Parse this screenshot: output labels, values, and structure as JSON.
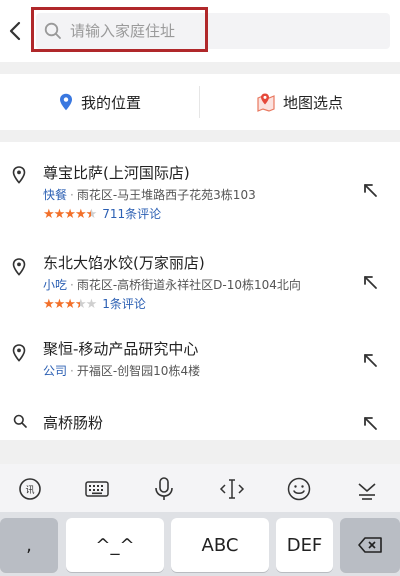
{
  "search": {
    "placeholder": "请输入家庭住址"
  },
  "location_bar": {
    "my_location": "我的位置",
    "map_pick": "地图选点"
  },
  "results": [
    {
      "name": "尊宝比萨(上河国际店)",
      "category": "快餐",
      "address": "雨花区-马王堆路西子花苑3栋103",
      "rating": 4.5,
      "reviews": "711条评论"
    },
    {
      "name": "东北大馅水饺(万家丽店)",
      "category": "小吃",
      "address": "雨花区-高桥街道永祥社区D-10栋104北向",
      "rating": 3.5,
      "reviews": "1条评论"
    },
    {
      "name": "聚恒-移动产品研究中心",
      "category": "公司",
      "address": "开福区-创智园10栋4楼"
    },
    {
      "name": "高桥肠粉"
    }
  ],
  "keyboard": {
    "keys": [
      ",",
      "^_^",
      "ABC",
      "DEF"
    ],
    "toolbar_icons": [
      "ime-logo-icon",
      "keyboard-icon",
      "microphone-icon",
      "text-cursor-icon",
      "emoji-icon",
      "collapse-keyboard-icon"
    ]
  },
  "colors": {
    "accent_blue": "#2b5fb3",
    "star_orange": "#f2702a",
    "highlight_red": "#b0282a"
  }
}
